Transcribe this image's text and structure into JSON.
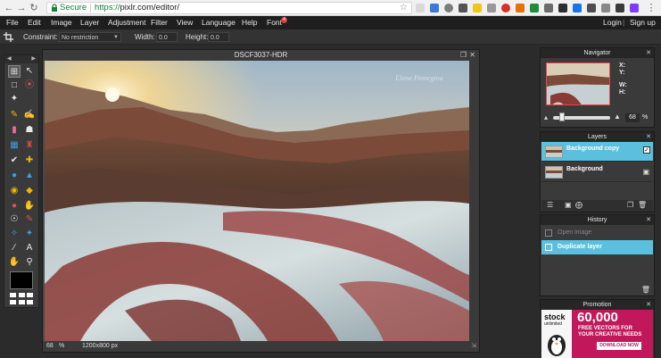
{
  "browser": {
    "secure_label": "Secure",
    "url_scheme": "https://",
    "url_rest": "pixlr.com/editor/",
    "accent": "#188038"
  },
  "menubar": {
    "items": [
      "File",
      "Edit",
      "Image",
      "Layer",
      "Adjustment",
      "Filter",
      "View",
      "Language",
      "Help",
      "Font"
    ],
    "font_badge": "4",
    "login": "Login",
    "divider": "|",
    "signup": "Sign up"
  },
  "options": {
    "constraint_label": "Constraint:",
    "constraint_value": "No restriction",
    "width_label": "Width:",
    "width_value": "0.0",
    "height_label": "Height:",
    "height_value": "0.0"
  },
  "document": {
    "title": "DSCF3037-HDR",
    "watermark": "Elena Pinnegina",
    "zoom": "68",
    "zoom_unit": "%",
    "size": "1200x800 px"
  },
  "navigator": {
    "title": "Navigator",
    "x_label": "X:",
    "y_label": "Y:",
    "w_label": "W:",
    "h_label": "H:",
    "zoom": "68",
    "zoom_unit": "%",
    "zoom_level": 0.15
  },
  "layers": {
    "title": "Layers",
    "items": [
      {
        "name": "Background copy",
        "selected": true
      },
      {
        "name": "Background",
        "selected": false
      }
    ]
  },
  "history": {
    "title": "History",
    "items": [
      {
        "name": "Open image",
        "selected": false
      },
      {
        "name": "Duplicate layer",
        "selected": true
      }
    ]
  },
  "promotion": {
    "title": "Promotion",
    "brand_top": "stock",
    "brand_bottom": "unlimited",
    "headline": "60,000",
    "line1": "FREE VECTORS FOR",
    "line2": "YOUR CREATIVE NEEDS",
    "cta": "DOWNLOAD NOW"
  },
  "colors": {
    "selection": "#5bc0de",
    "promo_bg": "#c2185b"
  }
}
